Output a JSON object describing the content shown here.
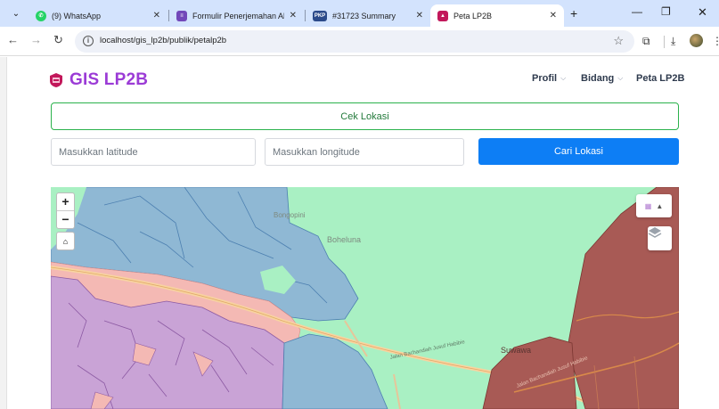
{
  "browser": {
    "tabs": [
      {
        "title": "(9) WhatsApp",
        "favicon": "whatsapp-icon",
        "color": "#25d366"
      },
      {
        "title": "Formulir Penerjemahan Abstrak",
        "favicon": "forms-icon",
        "color": "#7248b9"
      },
      {
        "title": "#31723 Summary",
        "favicon": "ojs-icon",
        "color": "#2b4a8a"
      },
      {
        "title": "Peta LP2B",
        "favicon": "lp2b-icon",
        "color": "#c2185b",
        "active": true
      }
    ],
    "new_tab": "+",
    "url": "localhost/gis_lp2b/publik/petalp2b"
  },
  "header": {
    "brand": "GIS LP2B",
    "brand_color": "#9b3bd6",
    "nav": [
      {
        "label": "Profil",
        "dropdown": true
      },
      {
        "label": "Bidang",
        "dropdown": true
      },
      {
        "label": "Peta LP2B",
        "dropdown": false
      }
    ]
  },
  "search": {
    "cek_lokasi": "Cek Lokasi",
    "latitude_placeholder": "Masukkan latitude",
    "longitude_placeholder": "Masukkan longitude",
    "cari_lokasi": "Cari Lokasi",
    "accent": "#0d7ef5"
  },
  "map": {
    "zoom_in": "+",
    "zoom_out": "−",
    "labels": {
      "village": "Suwawa",
      "road1": "Jalan Bachandiah Jusuf Habibie",
      "road2": "Jalan Bachandiah Jusuf Habibie"
    },
    "colors": {
      "background": "#a9f0c3",
      "zone_blue": "#8fb8d4",
      "zone_purple": "#c9a3d6",
      "zone_pink": "#f4b9b4",
      "zone_red": "#a85a55"
    }
  }
}
